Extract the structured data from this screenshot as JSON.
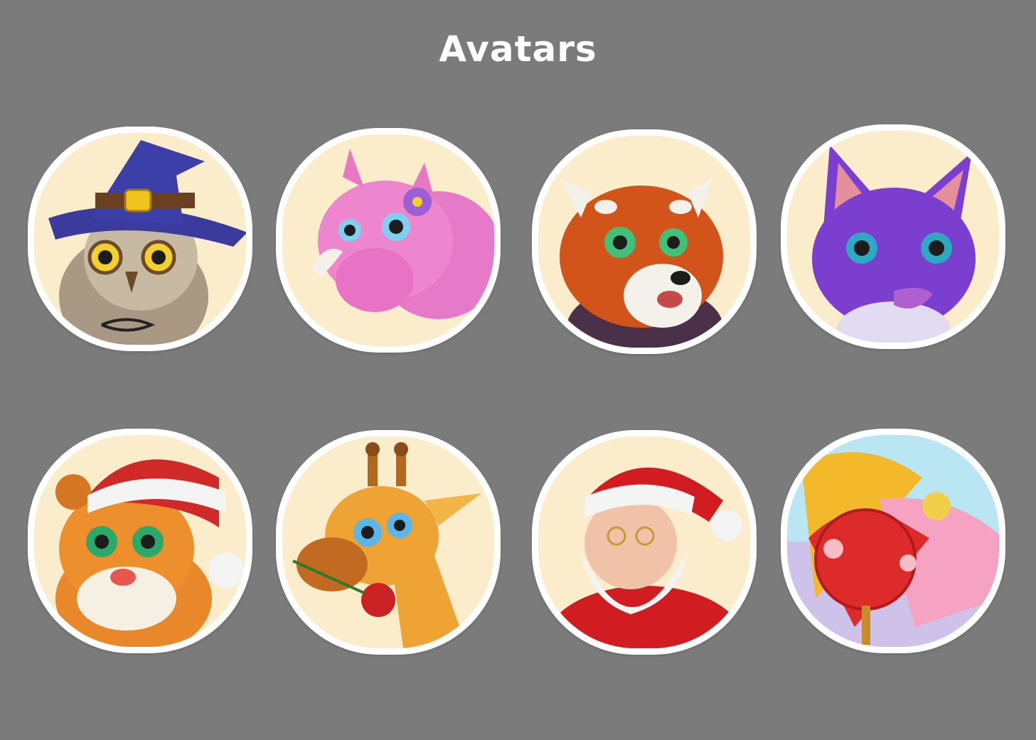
{
  "title": "Avatars",
  "avatars": [
    {
      "icon": "owl-wizard-icon",
      "bg": "#fbeccb"
    },
    {
      "icon": "pink-rhino-icon",
      "bg": "#fbeccb"
    },
    {
      "icon": "red-panda-icon",
      "bg": "#fbeccb"
    },
    {
      "icon": "purple-bat-icon",
      "bg": "#fbeccb"
    },
    {
      "icon": "tiger-santa-hat-icon",
      "bg": "#fbeccb"
    },
    {
      "icon": "giraffe-rose-icon",
      "bg": "#fbeccb"
    },
    {
      "icon": "santa-claus-icon",
      "bg": "#fbeccb"
    },
    {
      "icon": "chinese-fans-icon",
      "bg": "#b9e6f2"
    }
  ]
}
